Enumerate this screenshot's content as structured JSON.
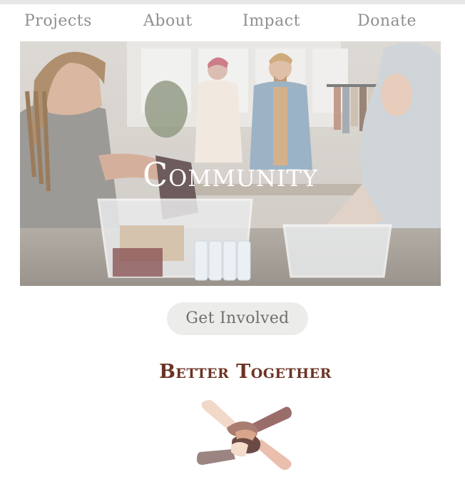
{
  "nav": {
    "items": [
      {
        "label": "Projects"
      },
      {
        "label": "About"
      },
      {
        "label": "Impact"
      },
      {
        "label": "Donate"
      }
    ]
  },
  "hero": {
    "title": "Community"
  },
  "cta": {
    "label": "Get Involved"
  },
  "tagline": "Better Together",
  "colors": {
    "nav_text": "#8f8f8f",
    "tagline": "#6b3324",
    "button_bg": "#ecedeb",
    "button_text": "#6f6f6f"
  },
  "icons": {
    "hands": "unity-hands-icon"
  }
}
